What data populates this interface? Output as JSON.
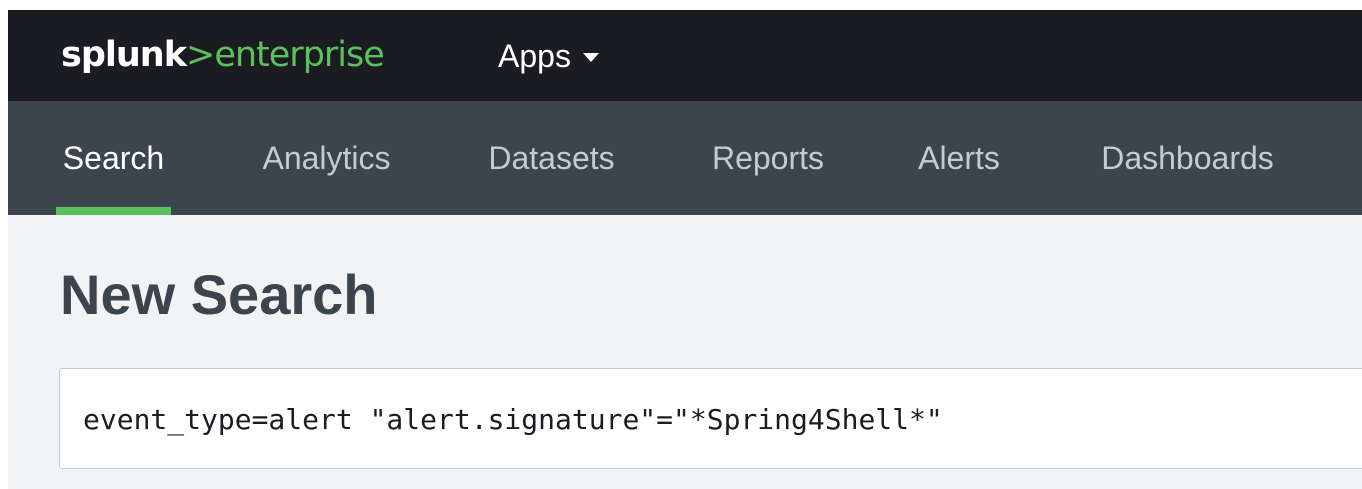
{
  "header": {
    "logo": {
      "brand": "splunk",
      "chevron": ">",
      "product": "enterprise"
    },
    "apps_label": "Apps",
    "apps_icon": "caret-down-icon"
  },
  "nav": {
    "tabs": [
      {
        "label": "Search",
        "active": true
      },
      {
        "label": "Analytics",
        "active": false
      },
      {
        "label": "Datasets",
        "active": false
      },
      {
        "label": "Reports",
        "active": false
      },
      {
        "label": "Alerts",
        "active": false
      },
      {
        "label": "Dashboards",
        "active": false
      }
    ]
  },
  "page": {
    "title": "New Search"
  },
  "search": {
    "query": "event_type=alert \"alert.signature\"=\"*Spring4Shell*\""
  },
  "colors": {
    "header_background": "#1a1c21",
    "nav_background": "#3c444d",
    "accent_green": "#5cc05c",
    "page_background": "#f2f3f5",
    "title_color": "#3c444d",
    "inactive_tab_color": "#c3cbd4"
  }
}
